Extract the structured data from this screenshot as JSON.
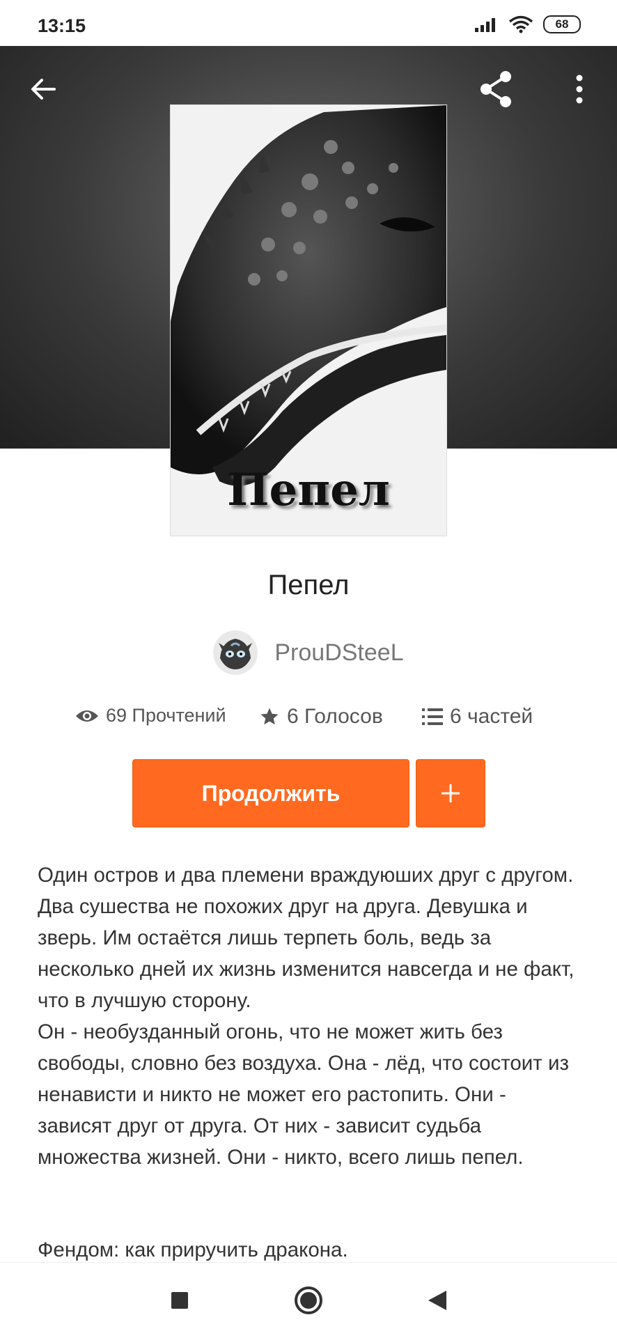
{
  "status_bar": {
    "time": "13:15",
    "battery": "68"
  },
  "toolbar": {
    "back_icon": "arrow-back-icon",
    "share_icon": "share-icon",
    "more_icon": "more-vert-icon"
  },
  "cover": {
    "title": "Пепел"
  },
  "story": {
    "title": "Пепел",
    "author": "ProuDSteeL",
    "reads": "69 Прочтений",
    "votes": "6 Голосов",
    "parts": "6 частей"
  },
  "actions": {
    "continue_label": "Продолжить",
    "add_label": "+"
  },
  "description": {
    "paragraph1": "Один остров и два племени враждуюших друг с другом. Два сушества не похожих друг на друга. Девушка и зверь. Им остаётся лишь терпеть боль, ведь за несколько дней их жизнь изменится навсегда и не факт, что в лучшую сторону.",
    "paragraph2": "Он - необузданный огонь, что не может жить без свободы, словно без воздуха. Она - лёд, что состоит из ненависти и никто не может его растопить. Они - зависят друг от друга. От них - зависит судьба множества жизней. Они - никто, всего лишь пепел.",
    "fandom": "Фендом: как приручить дракона."
  },
  "colors": {
    "accent": "#ff6a20",
    "header_bg": "#3a3a3a"
  }
}
